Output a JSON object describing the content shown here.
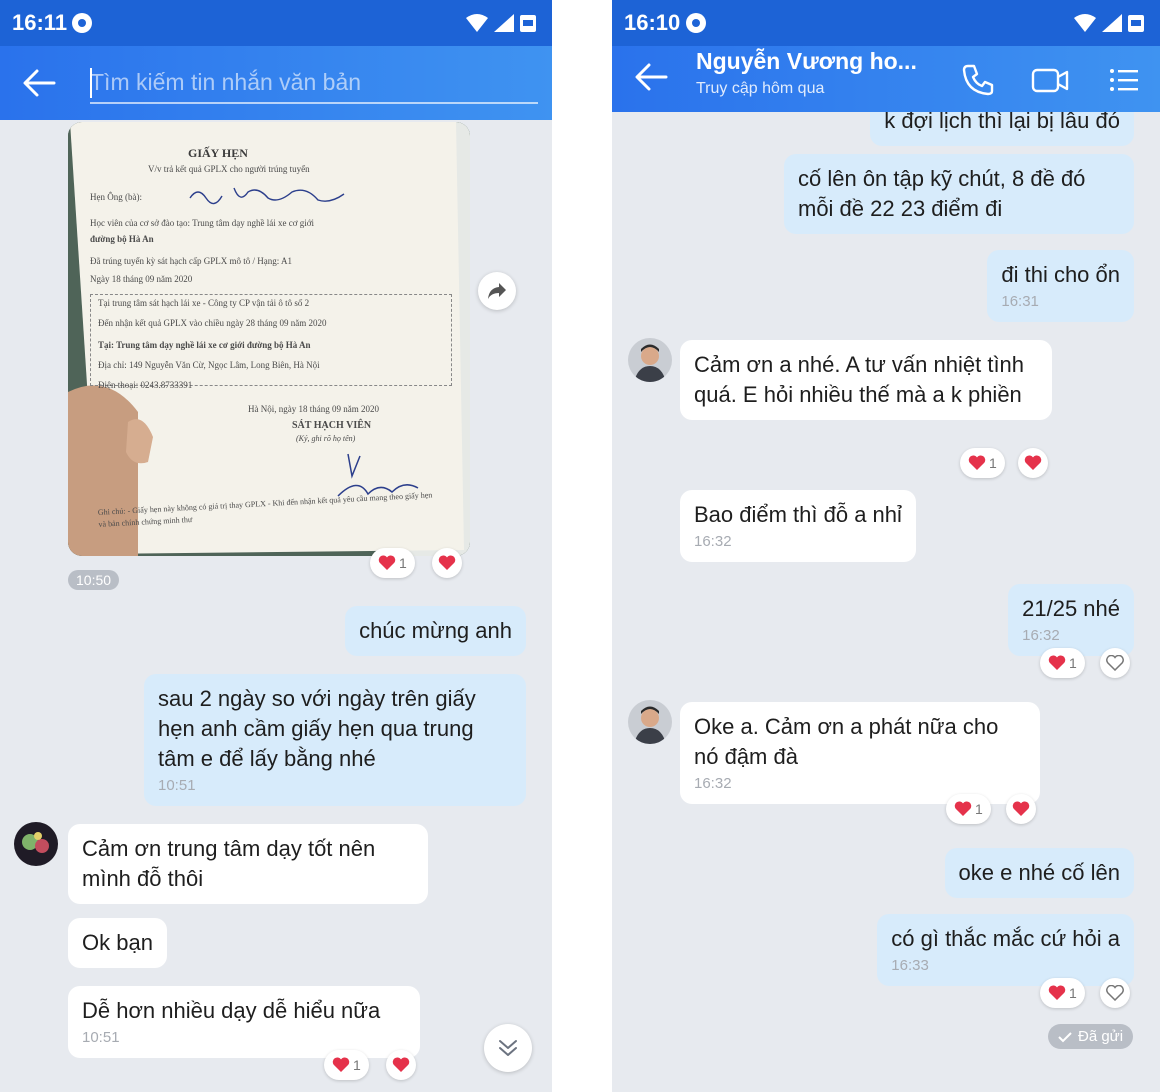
{
  "left": {
    "status": {
      "time": "16:11"
    },
    "search": {
      "placeholder": "Tìm kiếm tin nhắn văn bản"
    },
    "document": {
      "title": "GIẤY HẸN",
      "subtitle": "V/v trả kết quả GPLX cho người trúng tuyển",
      "lines": [
        "Hẹn Ông (bà):",
        "Học viên của cơ sở đào tạo: Trung tâm dạy nghề lái xe cơ giới",
        "đường bộ Hà An",
        "Đã trúng tuyển kỳ sát hạch cấp GPLX mô tô / Hạng: A1",
        "Ngày 18 tháng 09 năm 2020",
        "Tại trung tâm sát hạch lái xe - Công ty CP vận tải ô tô số 2",
        "Đến nhận kết quả GPLX vào chiều ngày 28 tháng 09 năm 2020",
        "Tại: Trung tâm dạy nghề lái xe cơ giới đường bộ Hà An",
        "Địa chỉ: 149 Nguyễn Văn Cừ, Ngọc Lâm, Long Biên, Hà Nội",
        "Điện thoại: 0243.8733391"
      ],
      "date_line": "Hà Nội, ngày 18 tháng 09 năm 2020",
      "signer": "SÁT HẠCH VIÊN",
      "signer_note": "(Ký, ghi rõ họ tên)",
      "footer": "Ghi chú: - Giấy hẹn này không có giá trị thay GPLX - Khi đến nhận kết quả yêu cầu mang theo giấy hẹn và bản chính chứng minh thư"
    },
    "photo_time": "10:50",
    "photo_reaction_count": "1",
    "messages": [
      {
        "text": "chúc mừng anh"
      },
      {
        "text": "sau 2 ngày so với ngày trên giấy hẹn anh cầm giấy hẹn qua trung tâm e để lấy bằng nhé",
        "time": "10:51"
      },
      {
        "text": "Cảm ơn trung tâm dạy tốt nên mình đỗ thôi"
      },
      {
        "text": "Ok bạn"
      },
      {
        "text": "Dễ hơn nhiều dạy dễ hiểu nữa",
        "time": "10:51",
        "reaction_count": "1"
      }
    ]
  },
  "right": {
    "status": {
      "time": "16:10"
    },
    "header": {
      "name": "Nguyễn Vương ho...",
      "subtitle": "Truy cập hôm qua"
    },
    "messages": [
      {
        "text": "k đợi lịch thì lại bị lâu đó"
      },
      {
        "text": "cố lên ôn tập kỹ chút, 8 đề đó mỗi đề 22 23 điểm đi"
      },
      {
        "text": "đi thi cho ổn",
        "time": "16:31"
      },
      {
        "text": "Cảm ơn a nhé. A tư vấn nhiệt tình quá. E hỏi nhiều thế mà a k phiền",
        "reaction_count": "1"
      },
      {
        "text": "Bao điểm thì đỗ a nhỉ",
        "time": "16:32"
      },
      {
        "text": "21/25 nhé",
        "time": "16:32",
        "reaction_count": "1"
      },
      {
        "text": "Oke a. Cảm ơn a phát nữa cho nó đậm đà",
        "time": "16:32",
        "reaction_count": "1"
      },
      {
        "text": "oke e nhé cố lên"
      },
      {
        "text": "có gì thắc mắc cứ hỏi a",
        "time": "16:33",
        "reaction_count": "1"
      }
    ],
    "sent_status": "Đã gửi"
  },
  "colors": {
    "header_blue": "#2a72ec",
    "outgoing_bubble": "#d7ebfb",
    "incoming_bubble": "#ffffff",
    "chat_background": "#e7eaef",
    "heart_red": "#e5324b"
  },
  "icons": [
    "back-arrow-icon",
    "phone-icon",
    "video-icon",
    "menu-list-icon",
    "share-icon",
    "heart-icon",
    "heart-outline-icon",
    "scroll-down-icon",
    "check-icon"
  ]
}
